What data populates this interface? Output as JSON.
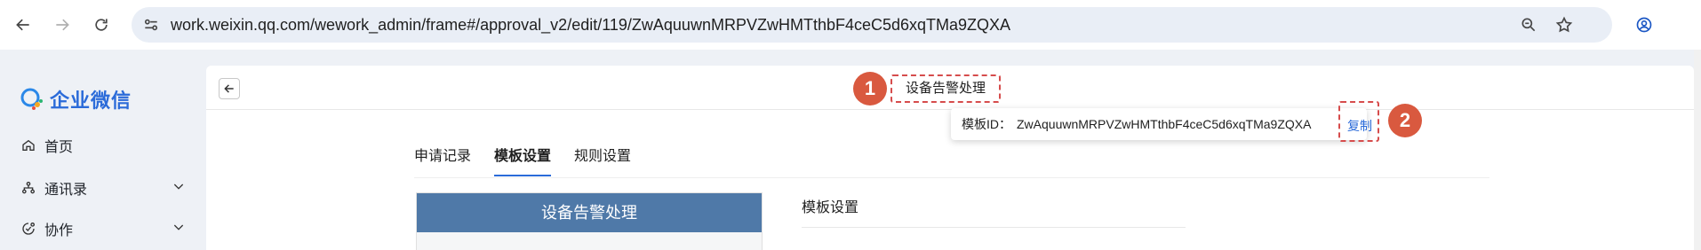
{
  "browser": {
    "url": "work.weixin.qq.com/wework_admin/frame#/approval_v2/edit/119/ZwAquuwnMRPVZwHMTthbF4ceC5d6xqTMa9ZQXA",
    "icons": [
      "back-arrow-icon",
      "forward-arrow-icon",
      "reload-icon",
      "site-settings-icon",
      "zoom-icon",
      "bookmark-star-icon",
      "profile-icon"
    ]
  },
  "sidebar": {
    "logo_text": "企业微信",
    "items": [
      {
        "label": "首页",
        "icon": "home-icon"
      },
      {
        "label": "通讯录",
        "icon": "org-chart-icon"
      },
      {
        "label": "协作",
        "icon": "collaboration-icon"
      }
    ]
  },
  "header": {
    "title": "设备告警处理"
  },
  "tooltip": {
    "label": "模板ID：",
    "value": "ZwAquuwnMRPVZwHMTthbF4ceC5d6xqTMa9ZQXA",
    "copy_label": "复制"
  },
  "markers": [
    "1",
    "2"
  ],
  "tabs": [
    {
      "label": "申请记录",
      "active": false
    },
    {
      "label": "模板设置",
      "active": true
    },
    {
      "label": "规则设置",
      "active": false
    }
  ],
  "preview": {
    "title": "设备告警处理"
  },
  "settings": {
    "title": "模板设置"
  },
  "colors": {
    "accent": "#2b6bd9",
    "preview_header": "#4f79a8",
    "marker": "#d9593f",
    "highlight_border": "#d64c4c"
  }
}
